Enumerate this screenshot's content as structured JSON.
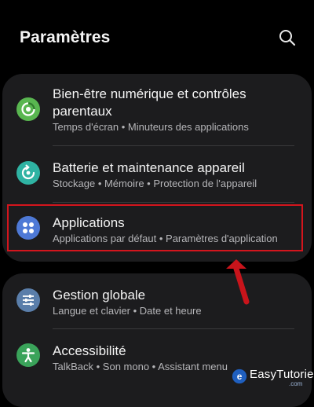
{
  "header": {
    "title": "Paramètres",
    "search_icon": "search-icon"
  },
  "settings": {
    "group1": [
      {
        "id": "digital-wellbeing",
        "icon": "digital-wellbeing-icon",
        "icon_color": "#59b650",
        "title": "Bien-être numérique et contrôles parentaux",
        "subtitle": "Temps d'écran  •  Minuteurs des applications"
      },
      {
        "id": "battery",
        "icon": "battery-care-icon",
        "icon_color": "#2fb3a3",
        "title": "Batterie et maintenance appareil",
        "subtitle": "Stockage  •  Mémoire  •  Protection de l'appareil"
      },
      {
        "id": "applications",
        "icon": "apps-icon",
        "icon_color": "#4e79d6",
        "title": "Applications",
        "subtitle": "Applications par défaut  •  Paramètres d'application"
      }
    ],
    "group2": [
      {
        "id": "general-management",
        "icon": "sliders-icon",
        "icon_color": "#5a7eaa",
        "title": "Gestion globale",
        "subtitle": "Langue et clavier  •  Date et heure"
      },
      {
        "id": "accessibility",
        "icon": "accessibility-icon",
        "icon_color": "#3aa35a",
        "title": "Accessibilité",
        "subtitle": "TalkBack  •  Son mono  •  Assistant menu"
      }
    ]
  },
  "annotation": {
    "highlight_color": "#d4151d"
  },
  "watermark": {
    "brand": "EasyTutoriel",
    "domain": ".com"
  }
}
